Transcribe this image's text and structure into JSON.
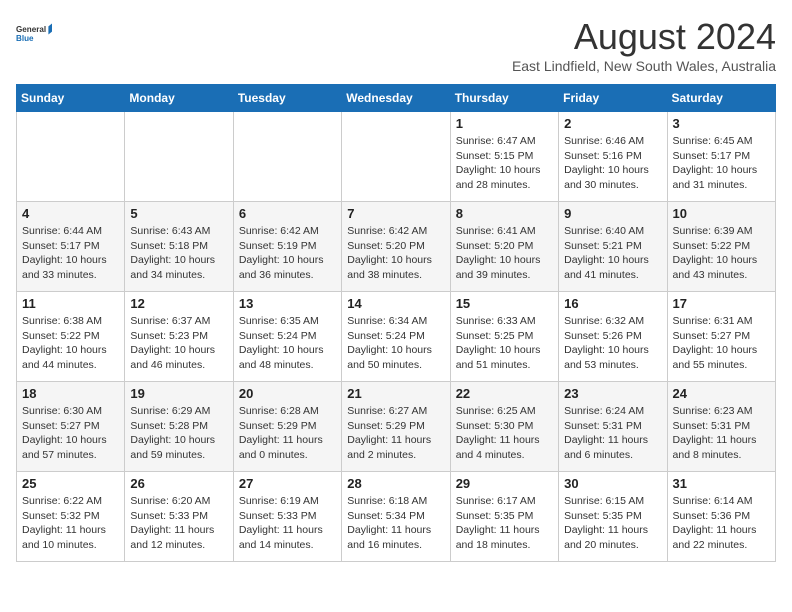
{
  "logo": {
    "line1": "General",
    "line2": "Blue"
  },
  "title": "August 2024",
  "location": "East Lindfield, New South Wales, Australia",
  "weekdays": [
    "Sunday",
    "Monday",
    "Tuesday",
    "Wednesday",
    "Thursday",
    "Friday",
    "Saturday"
  ],
  "weeks": [
    [
      {
        "day": "",
        "info": ""
      },
      {
        "day": "",
        "info": ""
      },
      {
        "day": "",
        "info": ""
      },
      {
        "day": "",
        "info": ""
      },
      {
        "day": "1",
        "info": "Sunrise: 6:47 AM\nSunset: 5:15 PM\nDaylight: 10 hours\nand 28 minutes."
      },
      {
        "day": "2",
        "info": "Sunrise: 6:46 AM\nSunset: 5:16 PM\nDaylight: 10 hours\nand 30 minutes."
      },
      {
        "day": "3",
        "info": "Sunrise: 6:45 AM\nSunset: 5:17 PM\nDaylight: 10 hours\nand 31 minutes."
      }
    ],
    [
      {
        "day": "4",
        "info": "Sunrise: 6:44 AM\nSunset: 5:17 PM\nDaylight: 10 hours\nand 33 minutes."
      },
      {
        "day": "5",
        "info": "Sunrise: 6:43 AM\nSunset: 5:18 PM\nDaylight: 10 hours\nand 34 minutes."
      },
      {
        "day": "6",
        "info": "Sunrise: 6:42 AM\nSunset: 5:19 PM\nDaylight: 10 hours\nand 36 minutes."
      },
      {
        "day": "7",
        "info": "Sunrise: 6:42 AM\nSunset: 5:20 PM\nDaylight: 10 hours\nand 38 minutes."
      },
      {
        "day": "8",
        "info": "Sunrise: 6:41 AM\nSunset: 5:20 PM\nDaylight: 10 hours\nand 39 minutes."
      },
      {
        "day": "9",
        "info": "Sunrise: 6:40 AM\nSunset: 5:21 PM\nDaylight: 10 hours\nand 41 minutes."
      },
      {
        "day": "10",
        "info": "Sunrise: 6:39 AM\nSunset: 5:22 PM\nDaylight: 10 hours\nand 43 minutes."
      }
    ],
    [
      {
        "day": "11",
        "info": "Sunrise: 6:38 AM\nSunset: 5:22 PM\nDaylight: 10 hours\nand 44 minutes."
      },
      {
        "day": "12",
        "info": "Sunrise: 6:37 AM\nSunset: 5:23 PM\nDaylight: 10 hours\nand 46 minutes."
      },
      {
        "day": "13",
        "info": "Sunrise: 6:35 AM\nSunset: 5:24 PM\nDaylight: 10 hours\nand 48 minutes."
      },
      {
        "day": "14",
        "info": "Sunrise: 6:34 AM\nSunset: 5:24 PM\nDaylight: 10 hours\nand 50 minutes."
      },
      {
        "day": "15",
        "info": "Sunrise: 6:33 AM\nSunset: 5:25 PM\nDaylight: 10 hours\nand 51 minutes."
      },
      {
        "day": "16",
        "info": "Sunrise: 6:32 AM\nSunset: 5:26 PM\nDaylight: 10 hours\nand 53 minutes."
      },
      {
        "day": "17",
        "info": "Sunrise: 6:31 AM\nSunset: 5:27 PM\nDaylight: 10 hours\nand 55 minutes."
      }
    ],
    [
      {
        "day": "18",
        "info": "Sunrise: 6:30 AM\nSunset: 5:27 PM\nDaylight: 10 hours\nand 57 minutes."
      },
      {
        "day": "19",
        "info": "Sunrise: 6:29 AM\nSunset: 5:28 PM\nDaylight: 10 hours\nand 59 minutes."
      },
      {
        "day": "20",
        "info": "Sunrise: 6:28 AM\nSunset: 5:29 PM\nDaylight: 11 hours\nand 0 minutes."
      },
      {
        "day": "21",
        "info": "Sunrise: 6:27 AM\nSunset: 5:29 PM\nDaylight: 11 hours\nand 2 minutes."
      },
      {
        "day": "22",
        "info": "Sunrise: 6:25 AM\nSunset: 5:30 PM\nDaylight: 11 hours\nand 4 minutes."
      },
      {
        "day": "23",
        "info": "Sunrise: 6:24 AM\nSunset: 5:31 PM\nDaylight: 11 hours\nand 6 minutes."
      },
      {
        "day": "24",
        "info": "Sunrise: 6:23 AM\nSunset: 5:31 PM\nDaylight: 11 hours\nand 8 minutes."
      }
    ],
    [
      {
        "day": "25",
        "info": "Sunrise: 6:22 AM\nSunset: 5:32 PM\nDaylight: 11 hours\nand 10 minutes."
      },
      {
        "day": "26",
        "info": "Sunrise: 6:20 AM\nSunset: 5:33 PM\nDaylight: 11 hours\nand 12 minutes."
      },
      {
        "day": "27",
        "info": "Sunrise: 6:19 AM\nSunset: 5:33 PM\nDaylight: 11 hours\nand 14 minutes."
      },
      {
        "day": "28",
        "info": "Sunrise: 6:18 AM\nSunset: 5:34 PM\nDaylight: 11 hours\nand 16 minutes."
      },
      {
        "day": "29",
        "info": "Sunrise: 6:17 AM\nSunset: 5:35 PM\nDaylight: 11 hours\nand 18 minutes."
      },
      {
        "day": "30",
        "info": "Sunrise: 6:15 AM\nSunset: 5:35 PM\nDaylight: 11 hours\nand 20 minutes."
      },
      {
        "day": "31",
        "info": "Sunrise: 6:14 AM\nSunset: 5:36 PM\nDaylight: 11 hours\nand 22 minutes."
      }
    ]
  ]
}
